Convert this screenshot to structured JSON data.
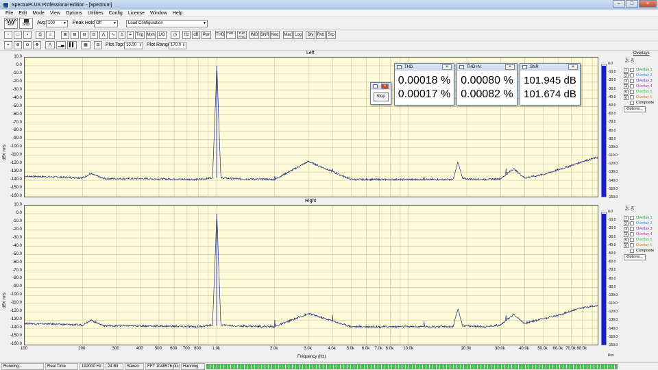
{
  "app": {
    "title": "SpectraPLUS Professional Edition - [Spectrum]"
  },
  "menu": [
    "File",
    "Edit",
    "Mode",
    "View",
    "Options",
    "Utilities",
    "Config",
    "License",
    "Window",
    "Help"
  ],
  "toolbar1": {
    "run_label": "Run",
    "stop_label": "Stop",
    "avg_label": "Avg:",
    "avg_value": "100",
    "peak_hold_label": "Peak Hold:",
    "peak_hold_value": "Off",
    "config_value": "Load Configuration"
  },
  "toolbar2": {
    "buttons": [
      "Trig",
      "Mxh",
      "1/O",
      "Hz",
      "dB",
      "Pwr",
      "THD",
      "THD+N",
      "THD Freq",
      "IMD",
      "SNR",
      "Noq",
      "Mac",
      "Log",
      "Dly",
      "Rvb",
      "Srp"
    ]
  },
  "toolbar3": {
    "plot_top_label": "Plot Top:",
    "plot_top_value": "10.00",
    "plot_range_label": "Plot Range:",
    "plot_range_value": "170.0"
  },
  "plots": [
    {
      "title": "Left"
    },
    {
      "title": "Right"
    }
  ],
  "y_axis": {
    "label": "dBV rms",
    "ticks": [
      "10.0",
      "0.0",
      "-10.0",
      "-20.0",
      "-30.0",
      "-40.0",
      "-50.0",
      "-60.0",
      "-70.0",
      "-80.0",
      "-90.0",
      "-100.0",
      "-110.0",
      "-120.0",
      "-130.0",
      "-140.0",
      "-150.0",
      "-160.0"
    ]
  },
  "x_axis": {
    "label": "Frequency (Hz)",
    "ticks": [
      "100",
      "200",
      "300",
      "400",
      "500",
      "600",
      "700",
      "800",
      "1.0k",
      "2.0k",
      "3.0k",
      "4.0k",
      "5.0k",
      "6.0k",
      "7.0k",
      "8.0k",
      "10.0k",
      "20.0k",
      "30.0k",
      "40.0k",
      "50.0k",
      "60.0k",
      "70.0k",
      "80.0k"
    ]
  },
  "meter": {
    "label": "Pwr",
    "ticks": [
      "0.0",
      "-10.0",
      "-20.0",
      "-30.0",
      "-40.0",
      "-50.0",
      "-60.0",
      "-70.0",
      "-80.0",
      "-90.0",
      "-100.0",
      "-110.0",
      "-120.0",
      "-130.0",
      "-140.0",
      "-150.0",
      "-160.0"
    ],
    "level_db": -2
  },
  "overlays": {
    "title": "Overlays",
    "sel_label": "Sel",
    "on_label": "On",
    "items": [
      {
        "num": "1",
        "label": "Overlay 1",
        "color": "#1e9a3a"
      },
      {
        "num": "2",
        "label": "Overlay 2",
        "color": "#2a9ad0"
      },
      {
        "num": "3",
        "label": "Overlay 3",
        "color": "#7a2ab8"
      },
      {
        "num": "4",
        "label": "Overlay 4",
        "color": "#c23aa8"
      },
      {
        "num": "5",
        "label": "Overlay 5",
        "color": "#2ab84a"
      },
      {
        "num": "6",
        "label": "Overlay 6",
        "color": "#d08a2a"
      }
    ],
    "composite_label": "Composite",
    "options_label": "Options..."
  },
  "popups": {
    "stop": {
      "button_label": "Stop"
    },
    "thd": {
      "title": "THD",
      "values": [
        "0.00018 %",
        "0.00017 %"
      ]
    },
    "thdn": {
      "title": "THD+N",
      "values": [
        "0.00080 %",
        "0.00082 %"
      ]
    },
    "snr": {
      "title": "SNR",
      "values": [
        "101.945 dB",
        "101.674 dB"
      ]
    }
  },
  "status": {
    "state": "Running...",
    "mode": "Real Time",
    "rate": "192000 Hz",
    "bits": "24 Bit",
    "channels": "Stereo",
    "fft": "FFT 1048576 pts",
    "window": "Hanning"
  },
  "colors": {
    "plot_bg": "#fffbd8",
    "trace": "#1a2a80",
    "meter": "#1a1ad0"
  },
  "chart_data": [
    {
      "type": "line",
      "title": "Left",
      "xlabel": "Frequency (Hz)",
      "ylabel": "dBV rms",
      "xscale": "log",
      "xlim": [
        100,
        96000
      ],
      "ylim": [
        -160,
        10
      ],
      "grid": true,
      "series": [
        {
          "x": [
            100,
            150,
            200,
            220,
            260,
            400,
            800,
            950,
            1000,
            1050,
            1200,
            2000,
            3000,
            5000,
            10000,
            17000,
            18000,
            19000,
            25000,
            30000,
            35000,
            40000,
            50000,
            60000,
            70000,
            80000,
            96000
          ],
          "y": [
            -135,
            -136,
            -137,
            -132,
            -138,
            -138,
            -139,
            -137,
            0,
            -137,
            -138,
            -139,
            -117,
            -139,
            -139,
            -139,
            -117,
            -138,
            -139,
            -138,
            -126,
            -137,
            -133,
            -127,
            -122,
            -117,
            -112
          ]
        }
      ]
    },
    {
      "type": "line",
      "title": "Right",
      "xlabel": "Frequency (Hz)",
      "ylabel": "dBV rms",
      "xscale": "log",
      "xlim": [
        100,
        96000
      ],
      "ylim": [
        -160,
        10
      ],
      "grid": true,
      "series": [
        {
          "x": [
            100,
            150,
            200,
            220,
            260,
            400,
            800,
            950,
            1000,
            1050,
            1200,
            2000,
            3000,
            5000,
            10000,
            17000,
            18000,
            19000,
            25000,
            30000,
            35000,
            40000,
            50000,
            60000,
            70000,
            80000,
            96000
          ],
          "y": [
            -134,
            -135,
            -136,
            -130,
            -137,
            -137,
            -138,
            -136,
            0,
            -136,
            -137,
            -138,
            -122,
            -138,
            -138,
            -138,
            -116,
            -137,
            -138,
            -136,
            -123,
            -134,
            -128,
            -124,
            -119,
            -115,
            -112
          ]
        }
      ]
    }
  ]
}
